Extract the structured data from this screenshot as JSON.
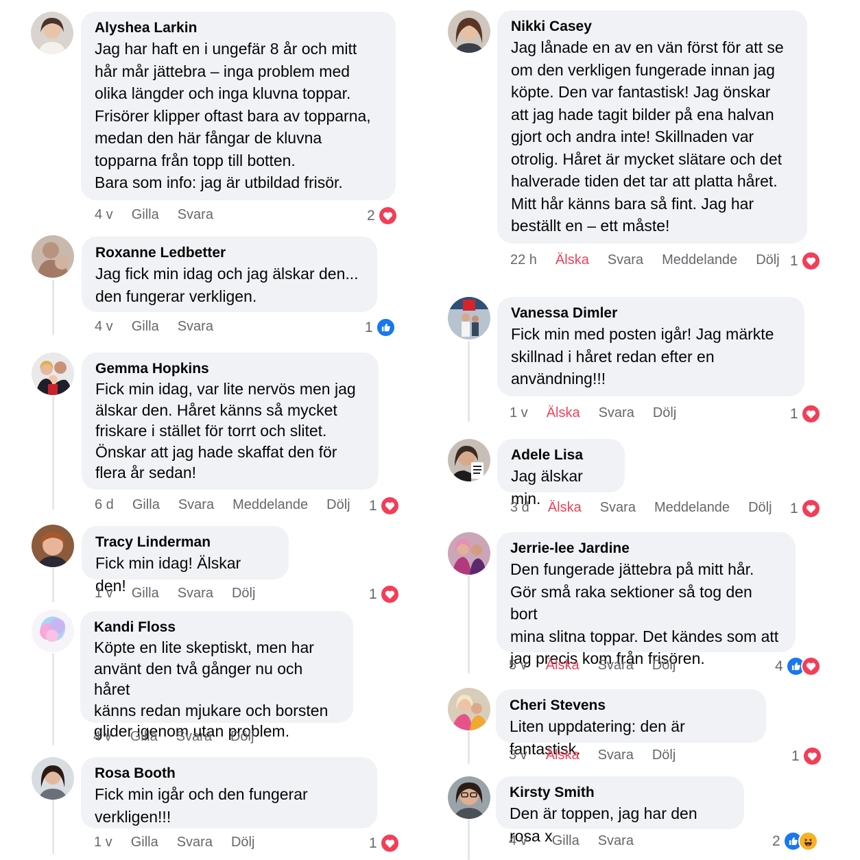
{
  "actions": {
    "gilla": "Gilla",
    "alska": "Älska",
    "svara": "Svara",
    "meddelande": "Meddelande",
    "dolj": "Dölj"
  },
  "colors": {
    "bubble": "#f0f2f5",
    "meta": "#65676b",
    "love": "#f33e58",
    "like": "#1877f2",
    "haha": "#f7b125"
  },
  "left": [
    {
      "name": "Alyshea Larkin",
      "text": "Jag har haft en i ungefär 8 år och mitt\nhår mår jättebra – inga problem med\nolika längder och inga kluvna toppar.\nFrisörer klipper oftast bara av topparna,\nmedan den här fångar de kluvna\ntopparna från topp till botten.\nBara som info: jag är utbildad frisör.",
      "time": "4 v",
      "count": "2",
      "reactions": [
        "heart-icon"
      ]
    },
    {
      "name": "Roxanne Ledbetter",
      "text": "Jag fick min idag och jag älskar den...\nden fungerar verkligen.",
      "time": "4 v",
      "count": "1",
      "reactions": [
        "like-icon"
      ]
    },
    {
      "name": "Gemma Hopkins",
      "text": "Fick min idag, var lite nervös men jag\nälskar den. Håret känns så mycket\nfriskare i stället för torrt och slitet.\nÖnskar att jag hade skaffat den för\nflera år sedan!",
      "time": "6 d",
      "count": "1",
      "reactions": [
        "heart-icon"
      ]
    },
    {
      "name": "Tracy Linderman",
      "text": "Fick min idag! Älskar den!",
      "time": "1 v",
      "count": "1",
      "reactions": [
        "heart-icon"
      ]
    },
    {
      "name": "Kandi Floss",
      "text": "Köpte en lite skeptiskt, men har\nanvänt den två gånger nu och håret\nkänns redan mjukare och borsten\nglider igenom utan problem.",
      "time": "4 v",
      "count": "",
      "reactions": []
    },
    {
      "name": "Rosa Booth",
      "text": "Fick min igår och den fungerar\nverkligen!!!",
      "time": "1 v",
      "count": "1",
      "reactions": [
        "heart-icon"
      ]
    }
  ],
  "right": [
    {
      "name": "Nikki Casey",
      "text": "Jag lånade en av en vän först för att se\nom den verkligen fungerade innan jag\nköpte. Den var fantastisk! Jag önskar\natt jag hade tagit bilder på ena halvan\ngjort och andra inte! Skillnaden var\notrolig. Håret är mycket slätare och det\nhalverade tiden det tar att platta håret.\nMitt hår känns bara så fint. Jag har\nbeställt en – ett måste!",
      "time": "22 h",
      "count": "1",
      "reactions": [
        "heart-icon"
      ]
    },
    {
      "name": "Vanessa Dimler",
      "text": "Fick min med posten igår! Jag märkte\nskillnad i håret redan efter en\nanvändning!!!",
      "time": "1 v",
      "count": "1",
      "reactions": [
        "heart-icon"
      ]
    },
    {
      "name": "Adele Lisa",
      "text": "Jag älskar min.",
      "time": "3 d",
      "count": "1",
      "reactions": [
        "heart-icon"
      ]
    },
    {
      "name": "Jerrie-lee Jardine",
      "text": "Den fungerade jättebra på mitt hår.\nGör små raka sektioner så tog den bort\nmina slitna toppar. Det kändes som att\njag precis kom från frisören.",
      "time": "5 v",
      "count": "4",
      "reactions": [
        "like-icon",
        "heart-icon"
      ]
    },
    {
      "name": "Cheri Stevens",
      "text": "Liten uppdatering: den är fantastisk.",
      "time": "3 v",
      "count": "1",
      "reactions": [
        "heart-icon"
      ]
    },
    {
      "name": "Kirsty Smith",
      "text": "Den är toppen, jag har den rosa x",
      "time": "4 v",
      "count": "2",
      "reactions": [
        "like-icon",
        "haha-icon"
      ]
    }
  ]
}
